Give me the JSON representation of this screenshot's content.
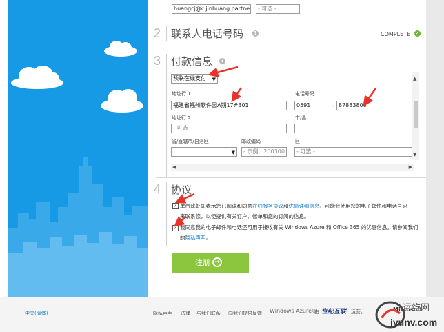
{
  "account": {
    "email_value": "huangcj@cijinhuang.partner.on",
    "domain_placeholder": "- 可选 -"
  },
  "section2": {
    "number": "2",
    "title": "联系人电话号码",
    "status": "COMPLETE"
  },
  "section3": {
    "number": "3",
    "title": "付款信息",
    "payment_method": "预联在线支付",
    "address1_label": "地址行 1",
    "address1_value": "福建省福州软件园A期17#301",
    "phone_label": "电话号码",
    "phone_area": "0591",
    "phone_sep": "-",
    "phone_number": "87883800",
    "address2_label": "地址行 2",
    "address2_placeholder": "- 可选 -",
    "city_label": "市/县",
    "province_label": "省/直辖市/自治区",
    "postal_label": "邮政编码",
    "postal_placeholder": "- 示例：200300 -",
    "district_label": "区",
    "district_placeholder": "- 可选 -"
  },
  "section4": {
    "number": "4",
    "title": "协议",
    "agree1_pre": "单击此处即表示您已阅读和同意",
    "agree1_link1": "在线服务协议",
    "agree1_and": "和",
    "agree1_link2": "优惠详细信息",
    "agree1_post1": "。可能会使用您的电子邮件和电话号码",
    "agree1_post2": "来联系您，以便提供有关订户、帐单和您的订阅的信息。",
    "agree2_line1": "我同意我的电子邮件和电话还可用于接收有关 Windows Azure 和 Office 365 的优惠信息。请参阅我们",
    "agree2_pre": "的",
    "agree2_link": "隐私声明",
    "agree2_post": "。"
  },
  "register_button": {
    "label": "注册"
  },
  "footer": {
    "language": "中文(简体)",
    "links": [
      "隐私声明",
      "法律",
      "与我们联系",
      "向我们提供反馈"
    ],
    "brand": "Windows Azure®",
    "by": "由",
    "partner": "世纪互联",
    "operated": "运营，",
    "microsoft": "Microsoft"
  },
  "watermark": {
    "title": "运维网",
    "url": "iyunv.com"
  },
  "colors": {
    "sky": "#169ae6",
    "register": "#8cc63f",
    "link": "#1a7cc9",
    "complete": "#6ab530",
    "arrow": "#e8322a"
  }
}
